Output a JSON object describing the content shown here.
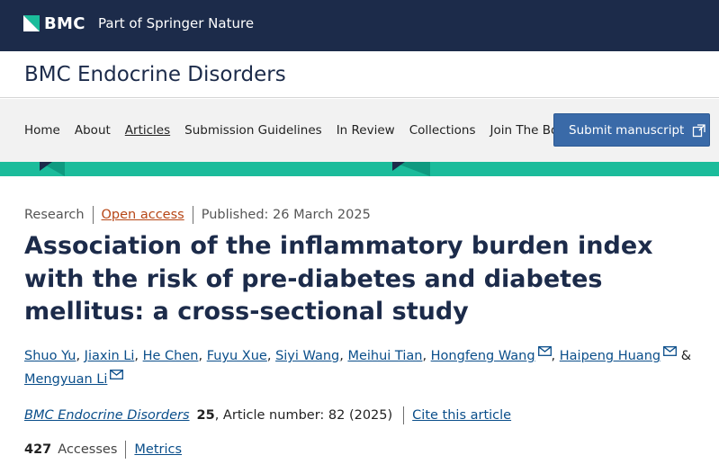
{
  "topbar": {
    "logo_text": "BMC",
    "springer_text": "Part of Springer Nature",
    "logo_icon": "bmc-logo-mark",
    "background": "#1c2b4a",
    "accent": "#1bbc9b"
  },
  "journal": {
    "title": "BMC Endocrine Disorders"
  },
  "nav": {
    "items": [
      {
        "label": "Home"
      },
      {
        "label": "About"
      },
      {
        "label": "Articles"
      },
      {
        "label": "Submission Guidelines"
      },
      {
        "label": "In Review"
      },
      {
        "label": "Collections"
      },
      {
        "label": "Join The Board"
      }
    ],
    "active_item": "Articles",
    "submit_label": "Submit manuscript",
    "submit_icon": "external-link-icon",
    "submit_color": "#3a6aa8"
  },
  "article": {
    "type": "Research",
    "open_access": "Open access",
    "published": "Published: 26 March 2025",
    "title": "Association of the inflammatory burden index with the risk of pre-diabetes and diabetes mellitus: a cross-sectional study",
    "authors": [
      {
        "name": "Shuo Yu",
        "sep": ", "
      },
      {
        "name": "Jiaxin Li",
        "sep": ", "
      },
      {
        "name": "He Chen",
        "sep": ", "
      },
      {
        "name": "Fuyu Xue",
        "sep": ", "
      },
      {
        "name": "Siyi Wang",
        "sep": ", "
      },
      {
        "name": "Meihui Tian",
        "sep": ", "
      },
      {
        "name": "Hongfeng Wang",
        "sep": ", "
      },
      {
        "name": "Haipeng Huang",
        "sep": " & "
      },
      {
        "name": "Mengyuan Li",
        "sep": ""
      }
    ],
    "mail_icon": "envelope-icon",
    "citation_journal": "BMC Endocrine Disorders",
    "citation_volume": "25",
    "citation_rest": ", Article number: 82 (2025)",
    "cite_label": "Cite this article",
    "accesses_count": "427",
    "accesses_label": "Accesses",
    "metrics_label": "Metrics",
    "link_color": "#0a4e8a",
    "oa_color": "#b74616"
  }
}
